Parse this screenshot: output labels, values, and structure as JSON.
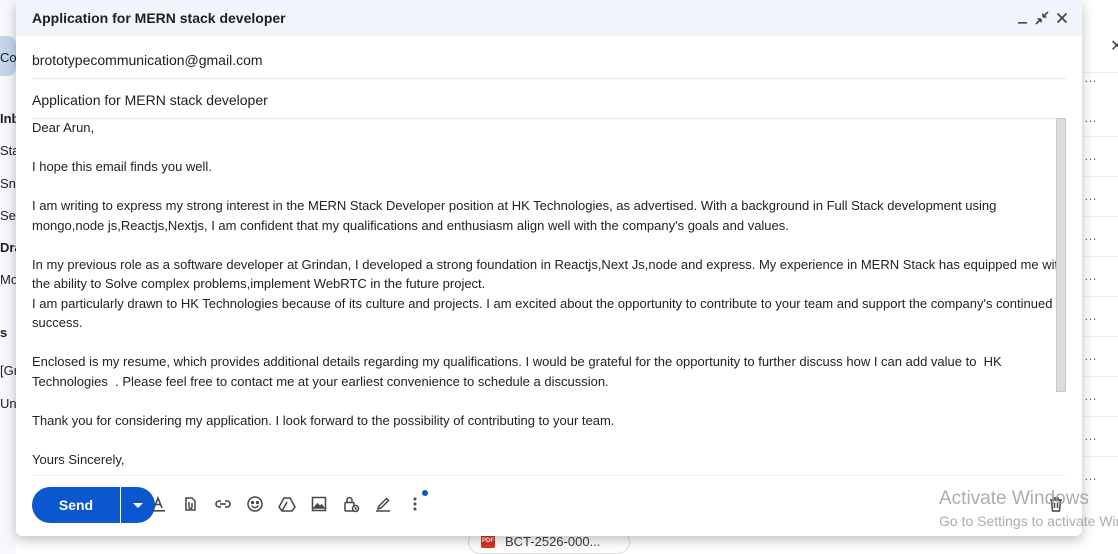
{
  "background": {
    "left_snippets": [
      "Co",
      "Inb",
      "Sta",
      "Sno",
      "Sen",
      "Dra",
      "Mo",
      "s",
      "[Gr",
      "Un"
    ],
    "attachment_name": "BCT-2526-000..."
  },
  "compose": {
    "title": "Application for MERN stack developer",
    "to": "brototypecommunication@gmail.com",
    "subject": "Application for MERN   stack developer",
    "body": [
      "Dear Arun,",
      "",
      "I hope this email finds you well.",
      "",
      "I am writing to express my strong interest in the MERN Stack Developer position at HK Technologies, as advertised. With a background in Full Stack development using mongo,node js,Reactjs,Nextjs, I am confident that my qualifications and enthusiasm align well with the company's goals and values.",
      "",
      "In my previous role as a software developer at Grindan, I developed a strong foundation in Reactjs,Next Js,node and express. My experience in MERN Stack has equipped me with the ability to Solve complex problems,implement WebRTC in the future project.",
      "I am particularly drawn to HK Technologies because of its culture and projects. I am excited about the opportunity to contribute to your team and support the company's continued success.",
      "",
      "Enclosed is my resume, which provides additional details regarding my qualifications. I would be grateful for the opportunity to further discuss how I can add value to  HK Technologies  . Please feel free to contact me at your earliest convenience to schedule a discussion.",
      "",
      "Thank you for considering my application. I look forward to the possibility of contributing to your team.",
      "",
      "Yours Sincerely,"
    ],
    "send_label": "Send"
  },
  "icons": {
    "minimize": "minimize-icon",
    "exit_fullscreen": "exit-fullscreen-icon",
    "close": "close-icon",
    "format": "text-format-icon",
    "attach": "attach-file-icon",
    "link": "insert-link-icon",
    "emoji": "emoji-icon",
    "drive": "drive-icon",
    "photo": "insert-photo-icon",
    "confidential": "confidential-mode-icon",
    "signature": "signature-icon",
    "more": "more-options-icon",
    "discard": "discard-draft-icon"
  },
  "watermark": {
    "line1": "Activate Windows",
    "line2": "Go to Settings to activate Windows."
  },
  "colors": {
    "accent": "#0b57d0",
    "header_bg": "#f2f6fc"
  }
}
